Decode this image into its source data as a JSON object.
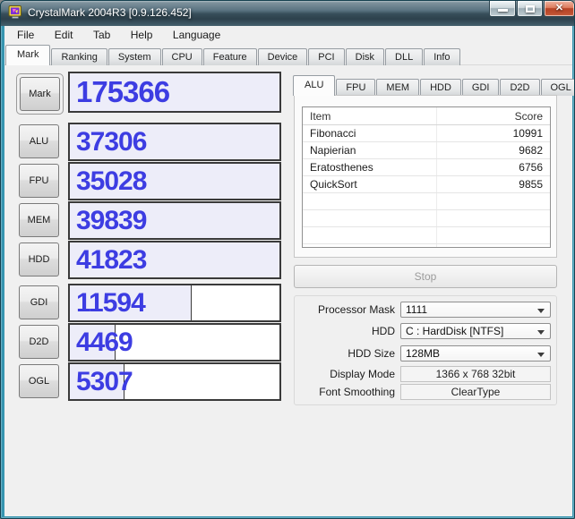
{
  "window": {
    "title": "CrystalMark 2004R3 [0.9.126.452]",
    "icons": {
      "close_glyph": "✕"
    }
  },
  "menu": {
    "items": [
      "File",
      "Edit",
      "Tab",
      "Help",
      "Language"
    ]
  },
  "tabs": {
    "selected": "Mark",
    "items": [
      "Mark",
      "Ranking",
      "System",
      "CPU",
      "Feature",
      "Device",
      "PCI",
      "Disk",
      "DLL",
      "Info"
    ]
  },
  "scores": {
    "rows": [
      {
        "label": "Mark",
        "value": "175366",
        "fill": 100
      },
      {
        "label": "ALU",
        "value": "37306",
        "fill": 100
      },
      {
        "label": "FPU",
        "value": "35028",
        "fill": 100
      },
      {
        "label": "MEM",
        "value": "39839",
        "fill": 100
      },
      {
        "label": "HDD",
        "value": "41823",
        "fill": 100
      },
      {
        "label": "GDI",
        "value": "11594",
        "fill": 58
      },
      {
        "label": "D2D",
        "value": "4469",
        "fill": 22
      },
      {
        "label": "OGL",
        "value": "5307",
        "fill": 26
      }
    ]
  },
  "detail": {
    "selected": "ALU",
    "tabs": [
      "ALU",
      "FPU",
      "MEM",
      "HDD",
      "GDI",
      "D2D",
      "OGL"
    ],
    "table": {
      "headers": [
        "Item",
        "Score"
      ],
      "rows": [
        {
          "item": "Fibonacci",
          "score": "10991"
        },
        {
          "item": "Napierian",
          "score": "9682"
        },
        {
          "item": "Eratosthenes",
          "score": "6756"
        },
        {
          "item": "QuickSort",
          "score": "9855"
        }
      ]
    }
  },
  "controls": {
    "stop_label": "Stop",
    "fields": [
      {
        "label": "Processor Mask",
        "value": "1111",
        "kind": "combo"
      },
      {
        "label": "HDD",
        "value": "C : HardDisk [NTFS]",
        "kind": "combo"
      },
      {
        "label": "HDD Size",
        "value": "128MB",
        "kind": "combo"
      },
      {
        "label": "Display Mode",
        "value": "1366 x 768 32bit",
        "kind": "static"
      },
      {
        "label": "Font Smoothing",
        "value": "ClearType",
        "kind": "static"
      }
    ]
  },
  "colors": {
    "score_text": "#3d3de2",
    "score_fill": "#ededf9",
    "frame": "#3795b0",
    "client_bg": "#f0f0f0",
    "close_button": "#c14a2e"
  }
}
